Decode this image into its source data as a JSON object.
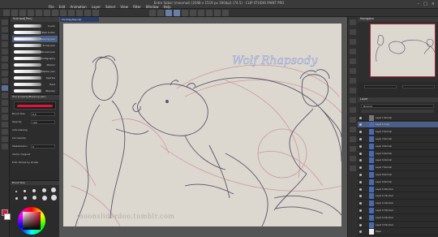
{
  "window": {
    "title": "Entre Sober (moomwi) (2048 x 1519 px 300dpi) (74.5) - CLIP STUDIO PAINT PRO"
  },
  "menu": [
    "File",
    "Edit",
    "Animation",
    "Layer",
    "Select",
    "View",
    "Filter",
    "Window",
    "Help"
  ],
  "document_tab": "CS-drag-Ray.clip",
  "subtool": {
    "header": "Sub tool[Pen]",
    "brushes": [
      {
        "name": "G pen"
      },
      {
        "name": "Real G-Pen"
      },
      {
        "name": "Mapping pen"
      },
      {
        "name": "Turnip pen"
      },
      {
        "name": "Textured pen"
      },
      {
        "name": "Calligraphy"
      },
      {
        "name": "Marker"
      },
      {
        "name": "Marker pen"
      },
      {
        "name": "Sparkle"
      },
      {
        "name": "Hard"
      },
      {
        "name": "Blender"
      }
    ]
  },
  "tool_property": {
    "header": "Tool property[Mapping pen]",
    "rows": [
      {
        "label": "Brush Size",
        "value": "8.0"
      },
      {
        "label": "Opacity",
        "value": "100"
      },
      {
        "label": "Anti-aliasing",
        "value": ""
      },
      {
        "label": "Ink Opacity",
        "value": ""
      },
      {
        "label": "Stabilization",
        "value": "6"
      },
      {
        "label": "Vector magnet",
        "value": ""
      },
      {
        "label": "Edit: Stroke by stroke",
        "value": ""
      }
    ]
  },
  "brush_size_header": "Brush Size",
  "canvas": {
    "watermark": "moonsliderdoo.tumblr.com",
    "handwriting": "Wolf Rhapsody"
  },
  "navigator": {
    "header": "Navigator"
  },
  "layers": {
    "header": "Layer",
    "blend_mode": "Normal",
    "rows": [
      {
        "name": "Layer 1 Normal",
        "selected": false,
        "folder": true
      },
      {
        "name": "Layer 1 Copy",
        "selected": true,
        "folder": false
      },
      {
        "name": "Layer 2 Normal",
        "selected": false,
        "folder": false
      },
      {
        "name": "Layer 3 Normal",
        "selected": false,
        "folder": false
      },
      {
        "name": "Layer 4 Normal",
        "selected": false,
        "folder": false
      },
      {
        "name": "Layer 5 Normal",
        "selected": false,
        "folder": false
      },
      {
        "name": "Layer 6 Normal",
        "selected": false,
        "folder": false
      },
      {
        "name": "Layer 7 Normal",
        "selected": false,
        "folder": false
      },
      {
        "name": "Layer 8 Normal",
        "selected": false,
        "folder": false
      },
      {
        "name": "Layer 9 Normal",
        "selected": false,
        "folder": false
      },
      {
        "name": "Layer 10 Normal",
        "selected": false,
        "folder": false
      },
      {
        "name": "Layer 11 Normal",
        "selected": false,
        "folder": false
      },
      {
        "name": "Layer 12 Normal",
        "selected": false,
        "folder": false
      },
      {
        "name": "Layer 13 Normal",
        "selected": false,
        "folder": false
      },
      {
        "name": "Layer 14 Normal",
        "selected": false,
        "folder": false
      },
      {
        "name": "Layer 15 Normal",
        "selected": false,
        "folder": false
      },
      {
        "name": "Paper",
        "selected": false,
        "folder": false
      }
    ]
  },
  "colors": {
    "main_color": "#e0153b",
    "sub_color": "#ffffff",
    "accent": "#4b5f88"
  }
}
